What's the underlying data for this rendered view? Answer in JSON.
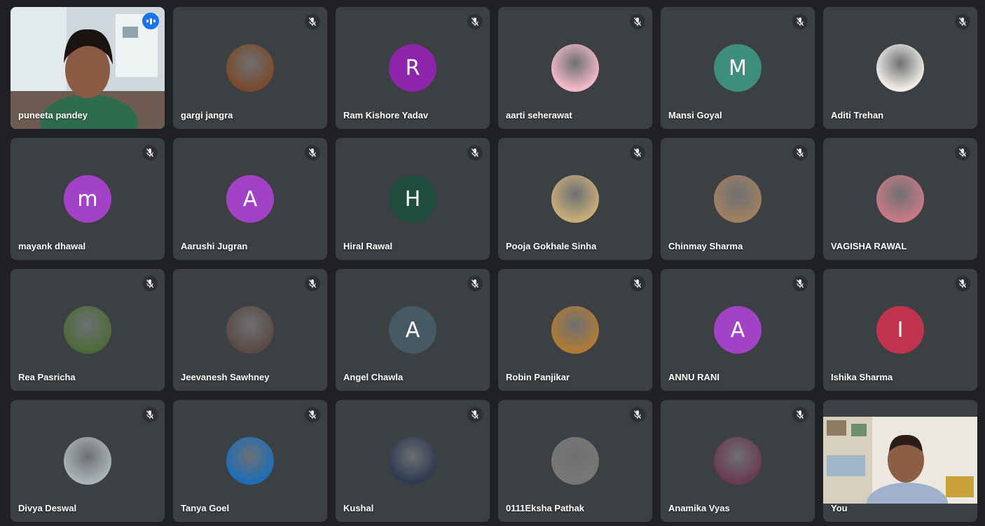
{
  "participants": [
    {
      "name": "puneeta pandey",
      "kind": "video",
      "speaking": true
    },
    {
      "name": "gargi jangra",
      "kind": "photo",
      "bg": "#7a4a2c"
    },
    {
      "name": "Ram Kishore Yadav",
      "kind": "letter",
      "letter": "R",
      "color": "#8e24aa"
    },
    {
      "name": "aarti seherawat",
      "kind": "photo",
      "bg": "#f3b9c8"
    },
    {
      "name": "Mansi Goyal",
      "kind": "letter",
      "letter": "M",
      "color": "#3e8e7e"
    },
    {
      "name": "Aditi Trehan",
      "kind": "photo",
      "bg": "#f0ece8"
    },
    {
      "name": "mayank dhawal",
      "kind": "letter",
      "letter": "m",
      "color": "#a142c7"
    },
    {
      "name": "Aarushi Jugran",
      "kind": "letter",
      "letter": "A",
      "color": "#a142c7"
    },
    {
      "name": "Hiral Rawal",
      "kind": "letter",
      "letter": "H",
      "color": "#1f4d3d"
    },
    {
      "name": "Pooja Gokhale Sinha",
      "kind": "photo",
      "bg": "#c8ad7a"
    },
    {
      "name": "Chinmay Sharma",
      "kind": "photo",
      "bg": "#a08062"
    },
    {
      "name": "VAGISHA RAWAL",
      "kind": "photo",
      "bg": "#c77a86"
    },
    {
      "name": "Rea Pasricha",
      "kind": "photo",
      "bg": "#4d6b3a"
    },
    {
      "name": "Jeevanesh Sawhney",
      "kind": "photo",
      "bg": "#5a4a45"
    },
    {
      "name": "Angel Chawla",
      "kind": "letter",
      "letter": "A",
      "color": "#455a64"
    },
    {
      "name": "Robin Panjikar",
      "kind": "photo",
      "bg": "#b07a35"
    },
    {
      "name": "ANNU RANI",
      "kind": "letter",
      "letter": "A",
      "color": "#a142c7"
    },
    {
      "name": "Ishika Sharma",
      "kind": "letter",
      "letter": "I",
      "color": "#c2334d"
    },
    {
      "name": "Divya Deswal",
      "kind": "photo",
      "bg": "#a9b3b8"
    },
    {
      "name": "Tanya Goel",
      "kind": "photo",
      "bg": "#1e6db8"
    },
    {
      "name": "Kushal",
      "kind": "photo",
      "bg": "#2e3a52"
    },
    {
      "name": "0111Eksha Pathak",
      "kind": "photo",
      "bg": "#777777"
    },
    {
      "name": "Anamika Vyas",
      "kind": "photo",
      "bg": "#6a3b54"
    },
    {
      "name": "You",
      "kind": "self"
    }
  ],
  "icons": {
    "muted": "mic-off-icon",
    "speaking": "audio-level-icon"
  }
}
